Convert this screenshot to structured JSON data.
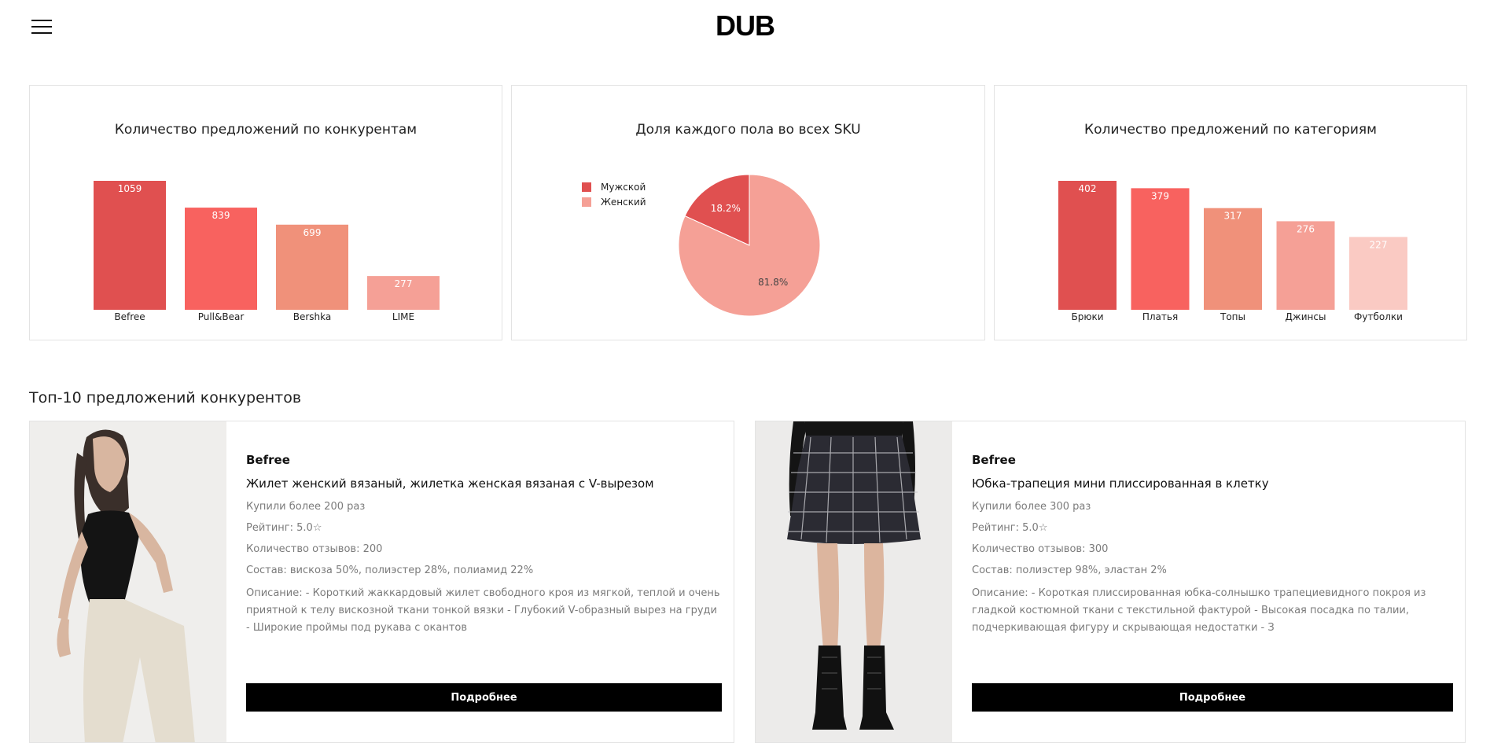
{
  "header": {
    "logo": "DUB"
  },
  "charts": [
    {
      "title": "Количество предложений по конкурентам",
      "chart_data": {
        "type": "bar",
        "categories": [
          "Befree",
          "Pull&Bear",
          "Bershka",
          "LIME"
        ],
        "values": [
          1059,
          839,
          699,
          277
        ],
        "colors": [
          "#e05050",
          "#f8625f",
          "#f0917a",
          "#f5a096"
        ],
        "ylim": [
          0,
          1059
        ]
      }
    },
    {
      "title": "Доля каждого пола во всех SKU",
      "chart_data": {
        "type": "pie",
        "categories": [
          "Мужской",
          "Женский"
        ],
        "values": [
          18.2,
          81.8
        ],
        "labels": [
          "18.2%",
          "81.8%"
        ],
        "colors": [
          "#e05050",
          "#f5a096"
        ],
        "legend": "top-left"
      }
    },
    {
      "title": "Количество предложений по категориям",
      "chart_data": {
        "type": "bar",
        "categories": [
          "Брюки",
          "Платья",
          "Топы",
          "Джинсы",
          "Футболки"
        ],
        "values": [
          402,
          379,
          317,
          276,
          227
        ],
        "colors": [
          "#e05050",
          "#f8625f",
          "#f0917a",
          "#f5a096",
          "#facac3"
        ],
        "ylim": [
          0,
          402
        ]
      }
    }
  ],
  "section": {
    "title": "Топ-10 предложений конкурентов"
  },
  "products": [
    {
      "brand": "Befree",
      "name": "Жилет женский вязаный, жилетка женская вязаная с V-вырезом",
      "bought": "Купили более 200 раз",
      "rating": "Рейтинг: 5.0☆",
      "reviews": "Количество отзывов: 200",
      "composition": "Состав: вискоза 50%, полиэстер 28%, полиамид 22%",
      "description": "Описание: - Короткий жаккардовый жилет свободного кроя из мягкой, теплой и очень приятной к телу вискозной ткани тонкой вязки - Глубокий V-образный вырез на груди - Широкие проймы под рукава с окантов",
      "button": "Подробнее"
    },
    {
      "brand": "Befree",
      "name": "Юбка-трапеция мини плиссированная в клетку",
      "bought": "Купили более 300 раз",
      "rating": "Рейтинг: 5.0☆",
      "reviews": "Количество отзывов: 300",
      "composition": "Состав: полиэстер 98%, эластан 2%",
      "description": "Описание: - Короткая плиссированная юбка-солнышко трапециевидного покроя из гладкой костюмной ткани с текстильной фактурой - Высокая посадка по талии, подчеркивающая фигуру и скрывающая недостатки - З",
      "button": "Подробнее"
    }
  ]
}
